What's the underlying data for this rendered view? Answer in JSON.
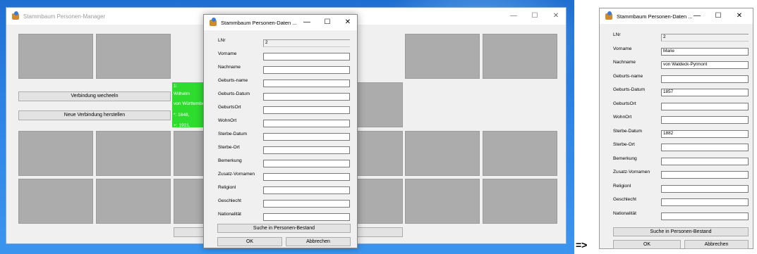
{
  "left_window": {
    "title": "Stammbaum Personen-Manager",
    "controls": {
      "minimize": "—",
      "maximize": "☐",
      "close": "✕"
    },
    "buttons": {
      "switch_connection": "Verbindung wecheeln",
      "new_connection": "Neue Verbindung herstellen"
    },
    "green_box_lines": [
      "1:",
      "Wilhelm",
      "von Württemberg",
      "*: 1848,",
      "+: 1921,"
    ]
  },
  "left_dialog": {
    "title": "Stammbaum Personen-Daten ...",
    "controls": {
      "minimize": "—",
      "maximize": "☐",
      "close": "✕"
    },
    "fields": [
      {
        "label": "LNr",
        "value": "2"
      },
      {
        "label": "Vorname",
        "value": ""
      },
      {
        "label": "Nachname",
        "value": ""
      },
      {
        "label": "Geburts-name",
        "value": ""
      },
      {
        "label": "Geburts-Datum",
        "value": ""
      },
      {
        "label": "GeburtsOrt",
        "value": ""
      },
      {
        "label": "WohnOrt",
        "value": ""
      },
      {
        "label": "Sterbe-Datum",
        "value": ""
      },
      {
        "label": "Sterbe-Ort",
        "value": ""
      },
      {
        "label": "Bemerkung",
        "value": ""
      },
      {
        "label": "Zusatz-Vornamen",
        "value": ""
      },
      {
        "label": "Religionl",
        "value": ""
      },
      {
        "label": "Geschlecht",
        "value": ""
      },
      {
        "label": "Nationalität",
        "value": ""
      }
    ],
    "search_button": "Suche in Personen-Bestand",
    "ok_button": "OK",
    "cancel_button": "Abbrechen"
  },
  "arrow": "=>",
  "right_dialog": {
    "title": "Stammbaum Personen-Daten ...",
    "controls": {
      "minimize": "—",
      "maximize": "☐",
      "close": "✕"
    },
    "fields": [
      {
        "label": "LNr",
        "value": "2"
      },
      {
        "label": "Vorname",
        "value": "Marie"
      },
      {
        "label": "Nachname",
        "value": "von Waldeck-Pyrmont"
      },
      {
        "label": "Geburts-name",
        "value": ""
      },
      {
        "label": "Geburts-Datum",
        "value": "1857"
      },
      {
        "label": "GeburtsOrt",
        "value": ""
      },
      {
        "label": "WohnOrt",
        "value": ""
      },
      {
        "label": "Sterbe-Datum",
        "value": "1882"
      },
      {
        "label": "Sterbe-Ort",
        "value": ""
      },
      {
        "label": "Bemerkung",
        "value": ""
      },
      {
        "label": "Zusatz-Vornamen",
        "value": ""
      },
      {
        "label": "Religionl",
        "value": ""
      },
      {
        "label": "Geschlecht",
        "value": ""
      },
      {
        "label": "Nationalität",
        "value": ""
      }
    ],
    "search_button": "Suche in Personen-Bestand",
    "ok_button": "OK",
    "cancel_button": "Abbrechen"
  }
}
